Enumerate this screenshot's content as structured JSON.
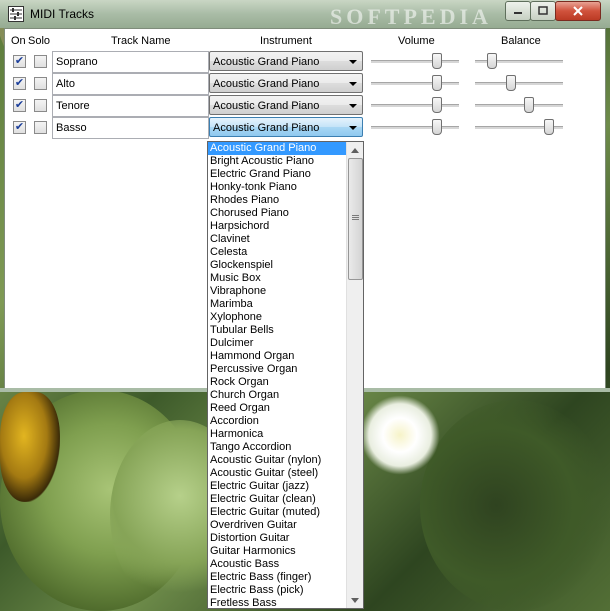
{
  "window": {
    "title": "MIDI Tracks"
  },
  "headers": {
    "on": "On",
    "solo": "Solo",
    "track_name": "Track Name",
    "instrument": "Instrument",
    "volume": "Volume",
    "balance": "Balance"
  },
  "tracks": [
    {
      "name": "Soprano",
      "on": true,
      "solo": false,
      "instrument": "Acoustic Grand Piano",
      "volume": 0.74,
      "balance": 0.18
    },
    {
      "name": "Alto",
      "on": true,
      "solo": false,
      "instrument": "Acoustic Grand Piano",
      "volume": 0.74,
      "balance": 0.4
    },
    {
      "name": "Tenore",
      "on": true,
      "solo": false,
      "instrument": "Acoustic Grand Piano",
      "volume": 0.74,
      "balance": 0.6
    },
    {
      "name": "Basso",
      "on": true,
      "solo": false,
      "instrument": "Acoustic Grand Piano",
      "volume": 0.74,
      "balance": 0.83
    }
  ],
  "dropdown": {
    "selected_index": 0,
    "items": [
      "Acoustic Grand Piano",
      "Bright Acoustic Piano",
      "Electric Grand Piano",
      "Honky-tonk Piano",
      "Rhodes Piano",
      "Chorused Piano",
      "Harpsichord",
      "Clavinet",
      "Celesta",
      "Glockenspiel",
      "Music Box",
      "Vibraphone",
      "Marimba",
      "Xylophone",
      "Tubular Bells",
      "Dulcimer",
      "Hammond Organ",
      "Percussive Organ",
      "Rock Organ",
      "Church Organ",
      "Reed Organ",
      "Accordion",
      "Harmonica",
      "Tango Accordion",
      "Acoustic Guitar (nylon)",
      "Acoustic Guitar (steel)",
      "Electric Guitar (jazz)",
      "Electric Guitar (clean)",
      "Electric Guitar (muted)",
      "Overdriven Guitar",
      "Distortion Guitar",
      "Guitar Harmonics",
      "Acoustic Bass",
      "Electric Bass (finger)",
      "Electric Bass (pick)",
      "Fretless Bass"
    ]
  },
  "icons": {
    "app": "midi-tracks-app-icon",
    "minimize": "minimize-icon",
    "maximize": "maximize-icon",
    "close": "close-icon"
  },
  "colors": {
    "selection": "#3399ff",
    "titlebar": "#a9bca6",
    "close": "#c8432c"
  }
}
